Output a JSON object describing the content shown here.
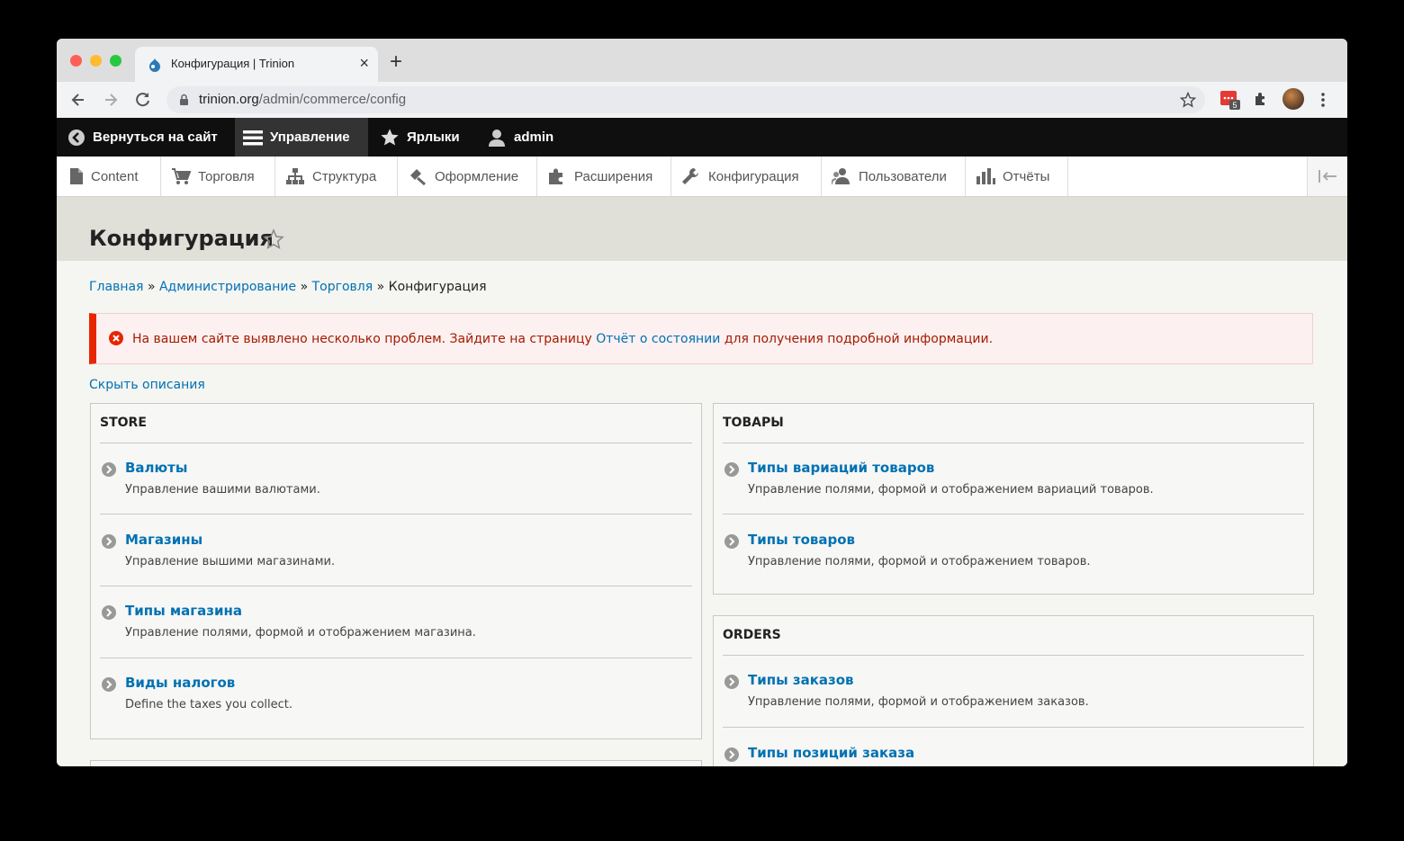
{
  "browser": {
    "tab_title": "Конфигурация | Trinion",
    "close_glyph": "×",
    "new_tab_glyph": "+",
    "url_host": "trinion.org",
    "url_path": "/admin/commerce/config",
    "extension_badge": "5"
  },
  "toolbar": {
    "back_to_site": "Вернуться на сайт",
    "manage": "Управление",
    "shortcuts": "Ярлыки",
    "user": "admin"
  },
  "tray": {
    "items": [
      "Content",
      "Торговля",
      "Структура",
      "Оформление",
      "Расширения",
      "Конфигурация",
      "Пользователи",
      "Отчёты"
    ]
  },
  "page": {
    "title": "Конфигурация"
  },
  "breadcrumb": {
    "items": [
      "Главная",
      "Администрирование",
      "Торговля"
    ],
    "separator": "»",
    "current": "Конфигурация"
  },
  "alert": {
    "text_before": "На вашем сайте выявлено несколько проблем. Зайдите на страницу",
    "link": "Отчёт о состоянии",
    "text_after": "для получения подробной информации."
  },
  "hide_descriptions": "Скрыть описания",
  "panels": {
    "store": {
      "title": "STORE",
      "entries": [
        {
          "title": "Валюты",
          "desc": "Управление вашими валютами."
        },
        {
          "title": "Магазины",
          "desc": "Управление вышими магазинами."
        },
        {
          "title": "Типы магазина",
          "desc": "Управление полями, формой и отображением магазина."
        },
        {
          "title": "Виды налогов",
          "desc": "Define the taxes you collect."
        }
      ]
    },
    "products": {
      "title": "ТОВАРЫ",
      "entries": [
        {
          "title": "Типы вариаций товаров",
          "desc": "Управление полями, формой и отображением вариаций товаров."
        },
        {
          "title": "Типы товаров",
          "desc": "Управление полями, формой и отображением товаров."
        }
      ]
    },
    "orders": {
      "title": "ORDERS",
      "entries": [
        {
          "title": "Типы заказов",
          "desc": "Управление полями, формой и отображением заказов."
        },
        {
          "title": "Типы позиций заказа",
          "desc": ""
        }
      ]
    }
  },
  "colors": {
    "link": "#0071b3",
    "error_border": "#e62600",
    "error_text": "#a51b00",
    "toolbar_bg": "#0f0f0f"
  }
}
